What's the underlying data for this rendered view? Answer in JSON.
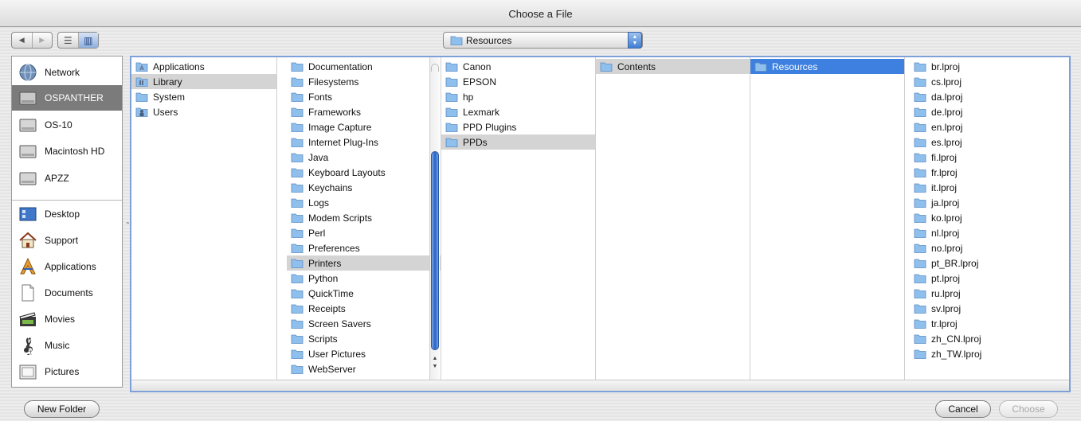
{
  "window": {
    "title": "Choose a File"
  },
  "toolbar": {
    "nav": {
      "back_glyph": "◀",
      "forward_glyph": "▶"
    },
    "view": {
      "list_glyph": "☰",
      "column_glyph": "▥"
    },
    "location_popup": {
      "value": "Resources",
      "icon": "folder-icon"
    }
  },
  "sidebar": {
    "devices": [
      {
        "label": "Network",
        "icon": "network-globe-icon",
        "selected": false
      },
      {
        "label": "OSPANTHER",
        "icon": "hard-drive-icon",
        "selected": true
      },
      {
        "label": "OS-10",
        "icon": "hard-drive-icon",
        "selected": false
      },
      {
        "label": "Macintosh HD",
        "icon": "hard-drive-icon",
        "selected": false
      },
      {
        "label": "APZZ",
        "icon": "hard-drive-icon",
        "selected": false
      }
    ],
    "places": [
      {
        "label": "Desktop",
        "icon": "desktop-icon"
      },
      {
        "label": "Support",
        "icon": "home-icon"
      },
      {
        "label": "Applications",
        "icon": "applications-icon"
      },
      {
        "label": "Documents",
        "icon": "document-icon"
      },
      {
        "label": "Movies",
        "icon": "movies-icon"
      },
      {
        "label": "Music",
        "icon": "music-icon"
      },
      {
        "label": "Pictures",
        "icon": "pictures-icon"
      }
    ]
  },
  "browser": {
    "columns": [
      {
        "items": [
          {
            "label": "Applications",
            "icon": "applications-folder-icon"
          },
          {
            "label": "Library",
            "icon": "library-folder-icon",
            "selected": "gray"
          },
          {
            "label": "System",
            "icon": "folder-icon"
          },
          {
            "label": "Users",
            "icon": "users-folder-icon"
          }
        ]
      },
      {
        "items": [
          {
            "label": "Documentation"
          },
          {
            "label": "Filesystems"
          },
          {
            "label": "Fonts"
          },
          {
            "label": "Frameworks"
          },
          {
            "label": "Image Capture"
          },
          {
            "label": "Internet Plug-Ins"
          },
          {
            "label": "Java"
          },
          {
            "label": "Keyboard Layouts"
          },
          {
            "label": "Keychains"
          },
          {
            "label": "Logs"
          },
          {
            "label": "Modem Scripts"
          },
          {
            "label": "Perl"
          },
          {
            "label": "Preferences"
          },
          {
            "label": "Printers",
            "selected": "gray"
          },
          {
            "label": "Python"
          },
          {
            "label": "QuickTime"
          },
          {
            "label": "Receipts"
          },
          {
            "label": "Screen Savers"
          },
          {
            "label": "Scripts"
          },
          {
            "label": "User Pictures"
          },
          {
            "label": "WebServer"
          }
        ]
      },
      {
        "items": [
          {
            "label": "Canon"
          },
          {
            "label": "EPSON"
          },
          {
            "label": "hp"
          },
          {
            "label": "Lexmark"
          },
          {
            "label": "PPD Plugins"
          },
          {
            "label": "PPDs",
            "selected": "gray"
          }
        ]
      },
      {
        "items": [
          {
            "label": "Contents",
            "selected": "gray"
          }
        ]
      },
      {
        "items": [
          {
            "label": "Resources",
            "selected": "blue"
          }
        ]
      },
      {
        "items": [
          {
            "label": "br.lproj"
          },
          {
            "label": "cs.lproj"
          },
          {
            "label": "da.lproj"
          },
          {
            "label": "de.lproj"
          },
          {
            "label": "en.lproj"
          },
          {
            "label": "es.lproj"
          },
          {
            "label": "fi.lproj"
          },
          {
            "label": "fr.lproj"
          },
          {
            "label": "it.lproj"
          },
          {
            "label": "ja.lproj"
          },
          {
            "label": "ko.lproj"
          },
          {
            "label": "nl.lproj"
          },
          {
            "label": "no.lproj"
          },
          {
            "label": "pt_BR.lproj"
          },
          {
            "label": "pt.lproj"
          },
          {
            "label": "ru.lproj"
          },
          {
            "label": "sv.lproj"
          },
          {
            "label": "tr.lproj"
          },
          {
            "label": "zh_CN.lproj"
          },
          {
            "label": "zh_TW.lproj"
          }
        ]
      }
    ]
  },
  "buttons": {
    "new_folder": "New Folder",
    "cancel": "Cancel",
    "choose": "Choose"
  },
  "colors": {
    "selection_blue": "#3d80df",
    "selection_gray": "#d4d4d4",
    "folder_blue": "#8fbfec"
  }
}
